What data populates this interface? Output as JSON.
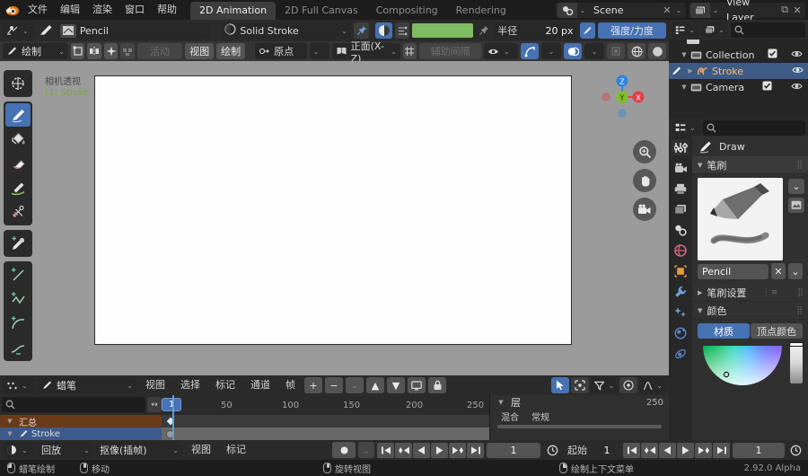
{
  "topbar": {
    "logo": "blender-logo",
    "menus": [
      "文件",
      "编辑",
      "渲染",
      "窗口",
      "帮助"
    ],
    "workspaces": [
      {
        "label": "2D Animation",
        "active": true
      },
      {
        "label": "2D Full Canvas",
        "active": false
      },
      {
        "label": "Compositing",
        "active": false
      },
      {
        "label": "Rendering",
        "active": false
      }
    ],
    "scene": {
      "name": "Scene",
      "x": "✕",
      "chev": "⌄"
    },
    "viewlayer": {
      "name": "View Layer",
      "copy": "⧉",
      "x": "✕"
    }
  },
  "tool_header": {
    "mode_icon": "cursor-mode-icon",
    "brush_icon": "brush-icon",
    "brush_name": "Pencil",
    "material_icon": "material-sphere-icon",
    "material_name": "Solid Stroke",
    "pin_icon": "pin-icon",
    "color_swatch": "#7fbb63",
    "radius_label": "半径",
    "radius_value": "20 px",
    "strength_label": "强度/力度",
    "pressure_icon": "pressure-pen-icon"
  },
  "tool_header2": {
    "draw_mode": "绘制",
    "snap_icons": [
      "transform-box-icon",
      "mirror-icon",
      "snap-star-icon",
      "multiframe-icon"
    ],
    "disabled_label": "活动",
    "view_btn": "视图",
    "draw_btn": "绘制",
    "origin_label": "原点",
    "plane_label": "正面(X-Z)",
    "guide_label": "辅助间隔",
    "guide_icon": "guides-icon",
    "overlay_icons": [
      "visibility-icon",
      "gizmo-icon",
      "overlay-icon",
      "xray-icon",
      "shading-wire-icon",
      "shading-solid-icon"
    ]
  },
  "viewport": {
    "camera_text": "相机透视",
    "object_text": "(1) Stroke",
    "tools": [
      {
        "name": "cursor-tool",
        "glyph": "⊕",
        "active": false
      },
      {
        "name": "draw-tool",
        "glyph": "✎",
        "active": true
      },
      {
        "name": "fill-tool",
        "glyph": "🪣",
        "active": false
      },
      {
        "name": "erase-tool",
        "glyph": "⌫",
        "active": false
      },
      {
        "name": "tint-tool",
        "glyph": "🖌",
        "active": false
      },
      {
        "name": "cutter-tool",
        "glyph": "✂",
        "active": false
      },
      {
        "name": "eyedropper-tool",
        "glyph": "💧",
        "active": false
      },
      {
        "name": "line-tool",
        "glyph": "╱",
        "active": false
      },
      {
        "name": "polyline-tool",
        "glyph": "∿",
        "active": false
      },
      {
        "name": "arc-tool",
        "glyph": "◜",
        "active": false
      },
      {
        "name": "curve-tool",
        "glyph": "⌒",
        "active": false
      }
    ],
    "gizmo_axes": [
      {
        "label": "Z",
        "color": "#2f83e3"
      },
      {
        "label": "Y",
        "color": "#7dc024"
      },
      {
        "label": "X",
        "color": "#e0404a"
      }
    ],
    "nav_buttons": [
      {
        "name": "zoom-nav-button",
        "glyph": "⌕"
      },
      {
        "name": "pan-nav-button",
        "glyph": "✋"
      },
      {
        "name": "camera-nav-button",
        "glyph": "🎥"
      }
    ]
  },
  "dopesheet": {
    "editor_icon": "dopesheet-icon",
    "mode_icon": "grease-pencil-icon",
    "mode_label": "蜡笔",
    "menus": [
      "视图",
      "选择",
      "标记",
      "通道",
      "帧"
    ],
    "add_label": "+",
    "sub_label": "−",
    "search_placeholder": "",
    "filter_icons": [
      "select-only-icon",
      "ghost-frames-icon",
      "filter-funnel-icon",
      "proportional-edit-icon",
      "falloff-icon"
    ],
    "ruler_ticks": [
      "1",
      "50",
      "100",
      "150",
      "200",
      "250"
    ],
    "current_frame": "1",
    "channels": [
      {
        "name": "汇总",
        "type": "summary",
        "keyframes": [
          1
        ]
      },
      {
        "name": "Stroke",
        "type": "object",
        "keyframes": [
          1
        ]
      }
    ],
    "layers_panel": {
      "title": "层",
      "blend_label": "混合",
      "blend_value": "常规"
    }
  },
  "outliner": {
    "display_mode_icon": "outliner-display-icon",
    "filter_icon": "outliner-filter-icon",
    "search_placeholder": "",
    "rows": [
      {
        "label": "Collection",
        "icon": "collection-icon",
        "indent": 0,
        "expanded": true,
        "selected": false,
        "checkbox": true,
        "eye": true
      },
      {
        "label": "Stroke",
        "icon": "grease-pencil-object-icon",
        "indent": 1,
        "expanded": false,
        "selected": true,
        "checkbox": false,
        "eye": true
      },
      {
        "label": "Camera",
        "icon": "collection-icon",
        "indent": 0,
        "expanded": true,
        "selected": false,
        "checkbox": true,
        "eye": true
      }
    ]
  },
  "properties": {
    "editor_icon": "properties-editor-icon",
    "search_placeholder": "",
    "tool_label": "Draw",
    "tool_icon": "brush-pencil-icon",
    "tabs": [
      {
        "name": "tool-tab",
        "glyph": "⚒",
        "active": true
      },
      {
        "name": "render-tab",
        "glyph": "📷",
        "active": false
      },
      {
        "name": "output-tab",
        "glyph": "🖨",
        "active": false
      },
      {
        "name": "view-layer-tab",
        "glyph": "🖼",
        "active": false
      },
      {
        "name": "scene-tab",
        "glyph": "⚲",
        "active": false
      },
      {
        "name": "world-tab",
        "glyph": "🌐",
        "active": false
      },
      {
        "name": "object-tab",
        "glyph": "◻",
        "active": false
      },
      {
        "name": "modifier-tab",
        "glyph": "🔧",
        "active": false
      },
      {
        "name": "visual-effects-tab",
        "glyph": "✨",
        "active": false
      },
      {
        "name": "physics-tab",
        "glyph": "◉",
        "active": false
      },
      {
        "name": "constraints-tab",
        "glyph": "◎",
        "active": false
      }
    ],
    "panels": {
      "brush": {
        "title": "笔刷",
        "preview_name": "pencil-brush-preview",
        "name": "Pencil",
        "clear": "✕",
        "chev": "⌄"
      },
      "brush_settings": {
        "title": "笔刷设置",
        "expanded": false
      },
      "color": {
        "title": "颜色",
        "tabs": [
          {
            "label": "材质",
            "active": true
          },
          {
            "label": "顶点颜色",
            "active": false
          }
        ]
      }
    }
  },
  "timeline": {
    "editor_icon": "timeline-icon",
    "menus": [
      "回放",
      "抠像(插帧)",
      "视图",
      "标记"
    ],
    "record_icon": "record-keyframe-icon",
    "keying_set_chev": "⌄",
    "transport": [
      "⏮",
      "⏪",
      "◀",
      "▶",
      "⏩",
      "⏭"
    ],
    "current_frame": "1",
    "start_label": "起始",
    "start_value": "1",
    "end_value": "1",
    "auto_key_icon": "auto-key-icon"
  },
  "statusbar": {
    "items": [
      {
        "mouse": "left",
        "label": "蜡笔绘制"
      },
      {
        "mouse": "middle",
        "label": "移动"
      },
      {
        "mouse": "middle",
        "label": "旋转视图"
      },
      {
        "mouse": "right",
        "label": "绘制上下文菜单"
      }
    ],
    "version": "2.92.0 Alpha"
  }
}
